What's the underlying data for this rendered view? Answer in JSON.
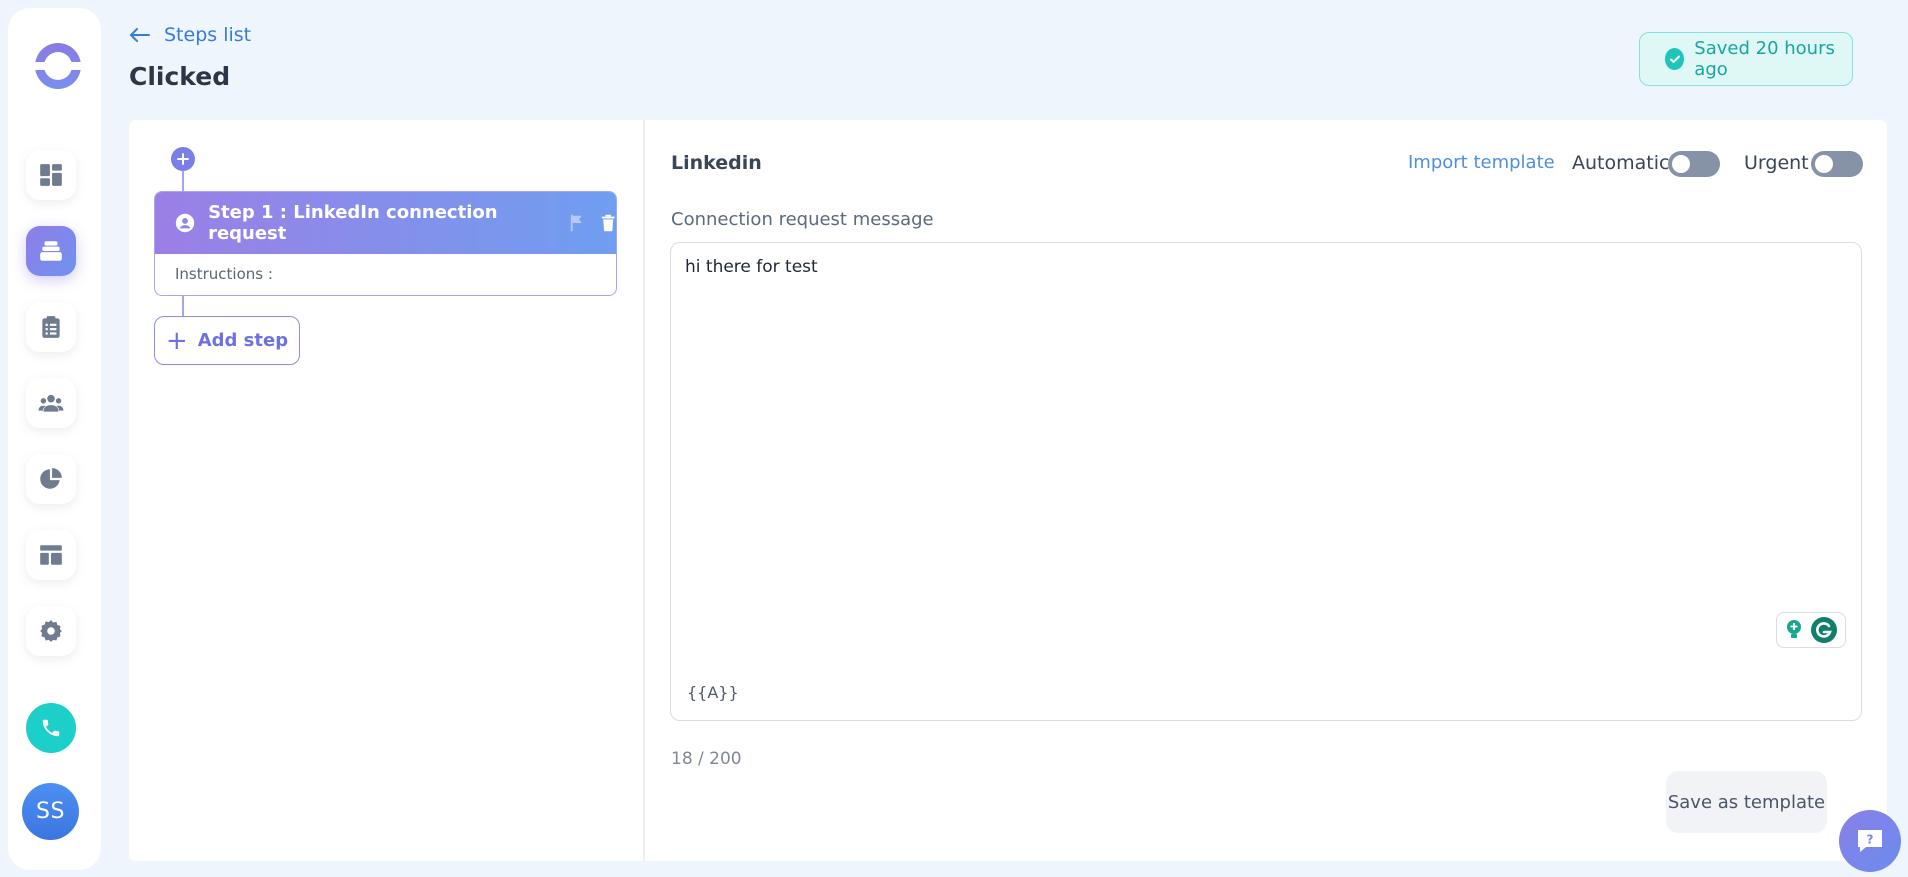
{
  "header": {
    "back_label": "Steps list",
    "title": "Clicked",
    "saved_status": "Saved 20 hours ago"
  },
  "sidebar": {
    "items": [
      {
        "icon": "dashboard-icon"
      },
      {
        "icon": "sequences-icon",
        "active": true
      },
      {
        "icon": "clipboard-icon"
      },
      {
        "icon": "users-icon"
      },
      {
        "icon": "pie-chart-icon"
      },
      {
        "icon": "template-layout-icon"
      },
      {
        "icon": "gear-icon"
      }
    ],
    "avatar_initials": "SS"
  },
  "steps": [
    {
      "title": "Step 1 : LinkedIn connection request",
      "instructions_label": "Instructions :"
    }
  ],
  "add_step_label": "Add step",
  "editor": {
    "channel": "Linkedin",
    "import_template_label": "Import template",
    "automatic_label": "Automatic",
    "automatic_on": false,
    "urgent_label": "Urgent",
    "urgent_on": false,
    "field_label": "Connection request message",
    "message": "hi there for test",
    "variable_tag": "{{A}}",
    "char_count": "18 / 200",
    "save_template_label": "Save as template"
  },
  "colors": {
    "accent_purple": "#8f7de6",
    "accent_blue": "#6f93f0",
    "saved_green": "#1aa69f",
    "phone_teal": "#1ccfc9"
  }
}
